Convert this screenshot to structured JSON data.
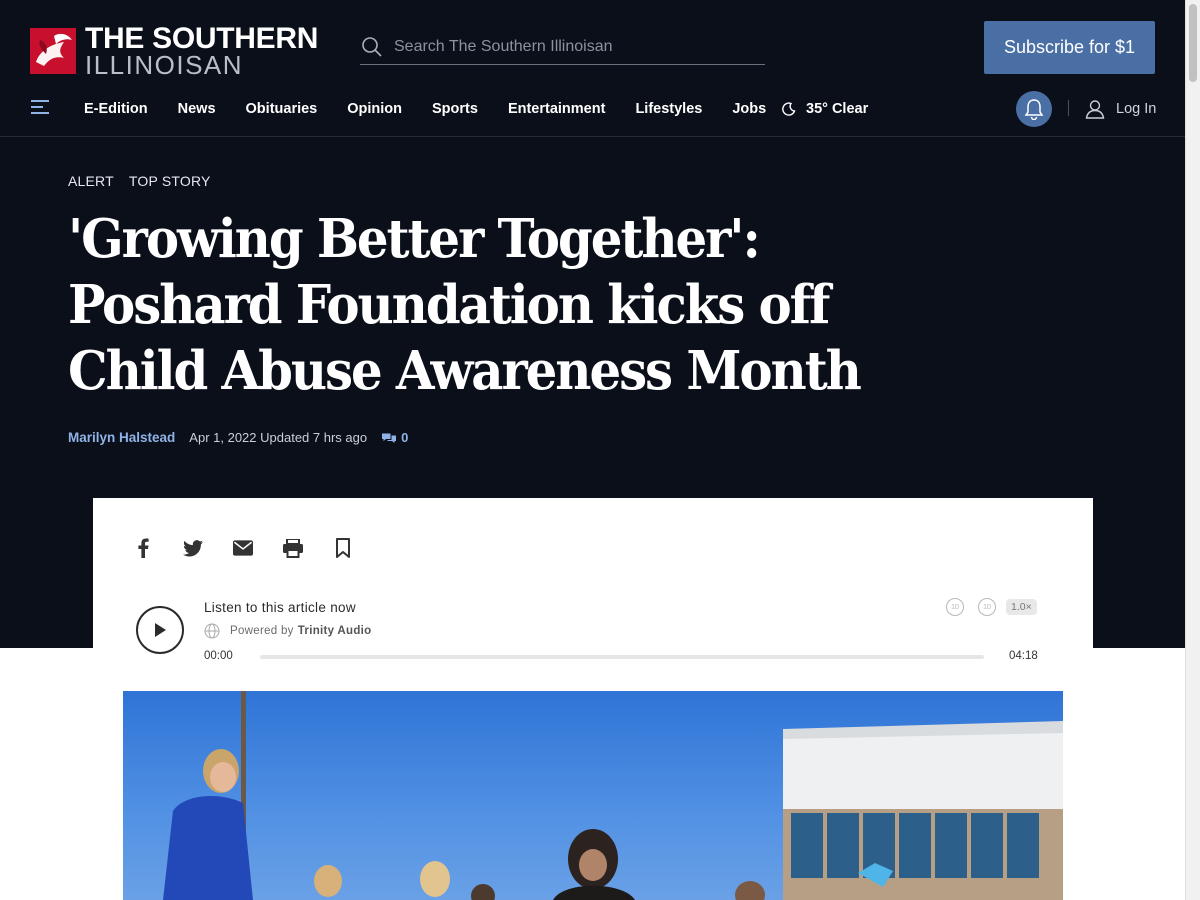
{
  "header": {
    "logo_line1": "THE SOUTHERN",
    "logo_line2": "ILLINOISAN",
    "search_placeholder": "Search The Southern Illinoisan",
    "subscribe_label": "Subscribe for $1"
  },
  "nav": {
    "items": [
      "E-Edition",
      "News",
      "Obituaries",
      "Opinion",
      "Sports",
      "Entertainment",
      "Lifestyles",
      "Jobs"
    ],
    "weather": "35° Clear",
    "login_label": "Log In"
  },
  "article": {
    "tags": [
      "ALERT",
      "TOP STORY"
    ],
    "headline": "'Growing Better Together': Poshard Foundation kicks off Child Abuse Awareness Month",
    "author": "Marilyn Halstead",
    "date": "Apr 1, 2022 Updated 7 hrs ago",
    "comment_count": "0"
  },
  "share_icons": [
    "facebook-icon",
    "twitter-icon",
    "email-icon",
    "print-icon",
    "bookmark-icon"
  ],
  "audio_player": {
    "title": "Listen to this article now",
    "powered_by_prefix": "Powered by",
    "powered_by_brand": "Trinity Audio",
    "current_time": "00:00",
    "duration": "04:18",
    "speed": "1.0×",
    "skip_back": "10",
    "skip_forward": "10",
    "progress": 0
  },
  "colors": {
    "background_dark": "#0b0f1a",
    "accent": "#4a6fa5",
    "link": "#8fb3e6",
    "logo_red": "#c8102e"
  }
}
